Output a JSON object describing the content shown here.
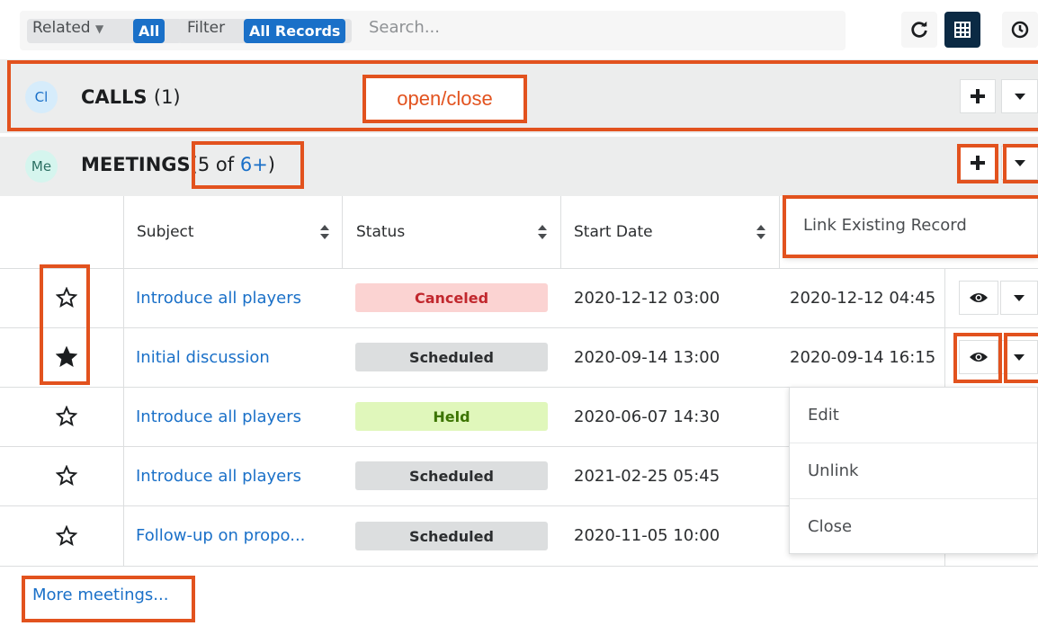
{
  "toolbar": {
    "related_label": "Related",
    "related_value": "All",
    "filter_label": "Filter",
    "filter_value": "All Records",
    "search_placeholder": "Search..."
  },
  "calls": {
    "avatar": "Cl",
    "title": "CALLS",
    "count": "(1)",
    "annotation": "open/close"
  },
  "meetings": {
    "avatar": "Me",
    "title": "MEETINGS",
    "count_prefix": "(5 of ",
    "count_link": "6+",
    "count_suffix": ")",
    "columns": [
      "Subject",
      "Status",
      "Start Date"
    ],
    "rows": [
      {
        "favorite": false,
        "subject": "Introduce all players",
        "status": "Canceled",
        "status_type": "canceled",
        "start": "2020-12-12 03:00",
        "end": "2020-12-12 04:45"
      },
      {
        "favorite": true,
        "subject": "Initial discussion",
        "status": "Scheduled",
        "status_type": "scheduled",
        "start": "2020-09-14 13:00",
        "end": "2020-09-14 16:15"
      },
      {
        "favorite": false,
        "subject": "Introduce all players",
        "status": "Held",
        "status_type": "held",
        "start": "2020-06-07 14:30",
        "end": ""
      },
      {
        "favorite": false,
        "subject": "Introduce all players",
        "status": "Scheduled",
        "status_type": "scheduled",
        "start": "2021-02-25 05:45",
        "end": ""
      },
      {
        "favorite": false,
        "subject": "Follow-up on propo...",
        "status": "Scheduled",
        "status_type": "scheduled",
        "start": "2020-11-05 10:00",
        "end": ""
      }
    ],
    "more_link": "More meetings..."
  },
  "header_menu": {
    "items": [
      "Link Existing Record"
    ]
  },
  "row_menu": {
    "items": [
      "Edit",
      "Unlink",
      "Close"
    ]
  },
  "colors": {
    "accent": "#1a70c8",
    "annotation": "#e2521e",
    "header_bg": "#eceded",
    "toolbar_dark_button": "#0b2a44"
  }
}
